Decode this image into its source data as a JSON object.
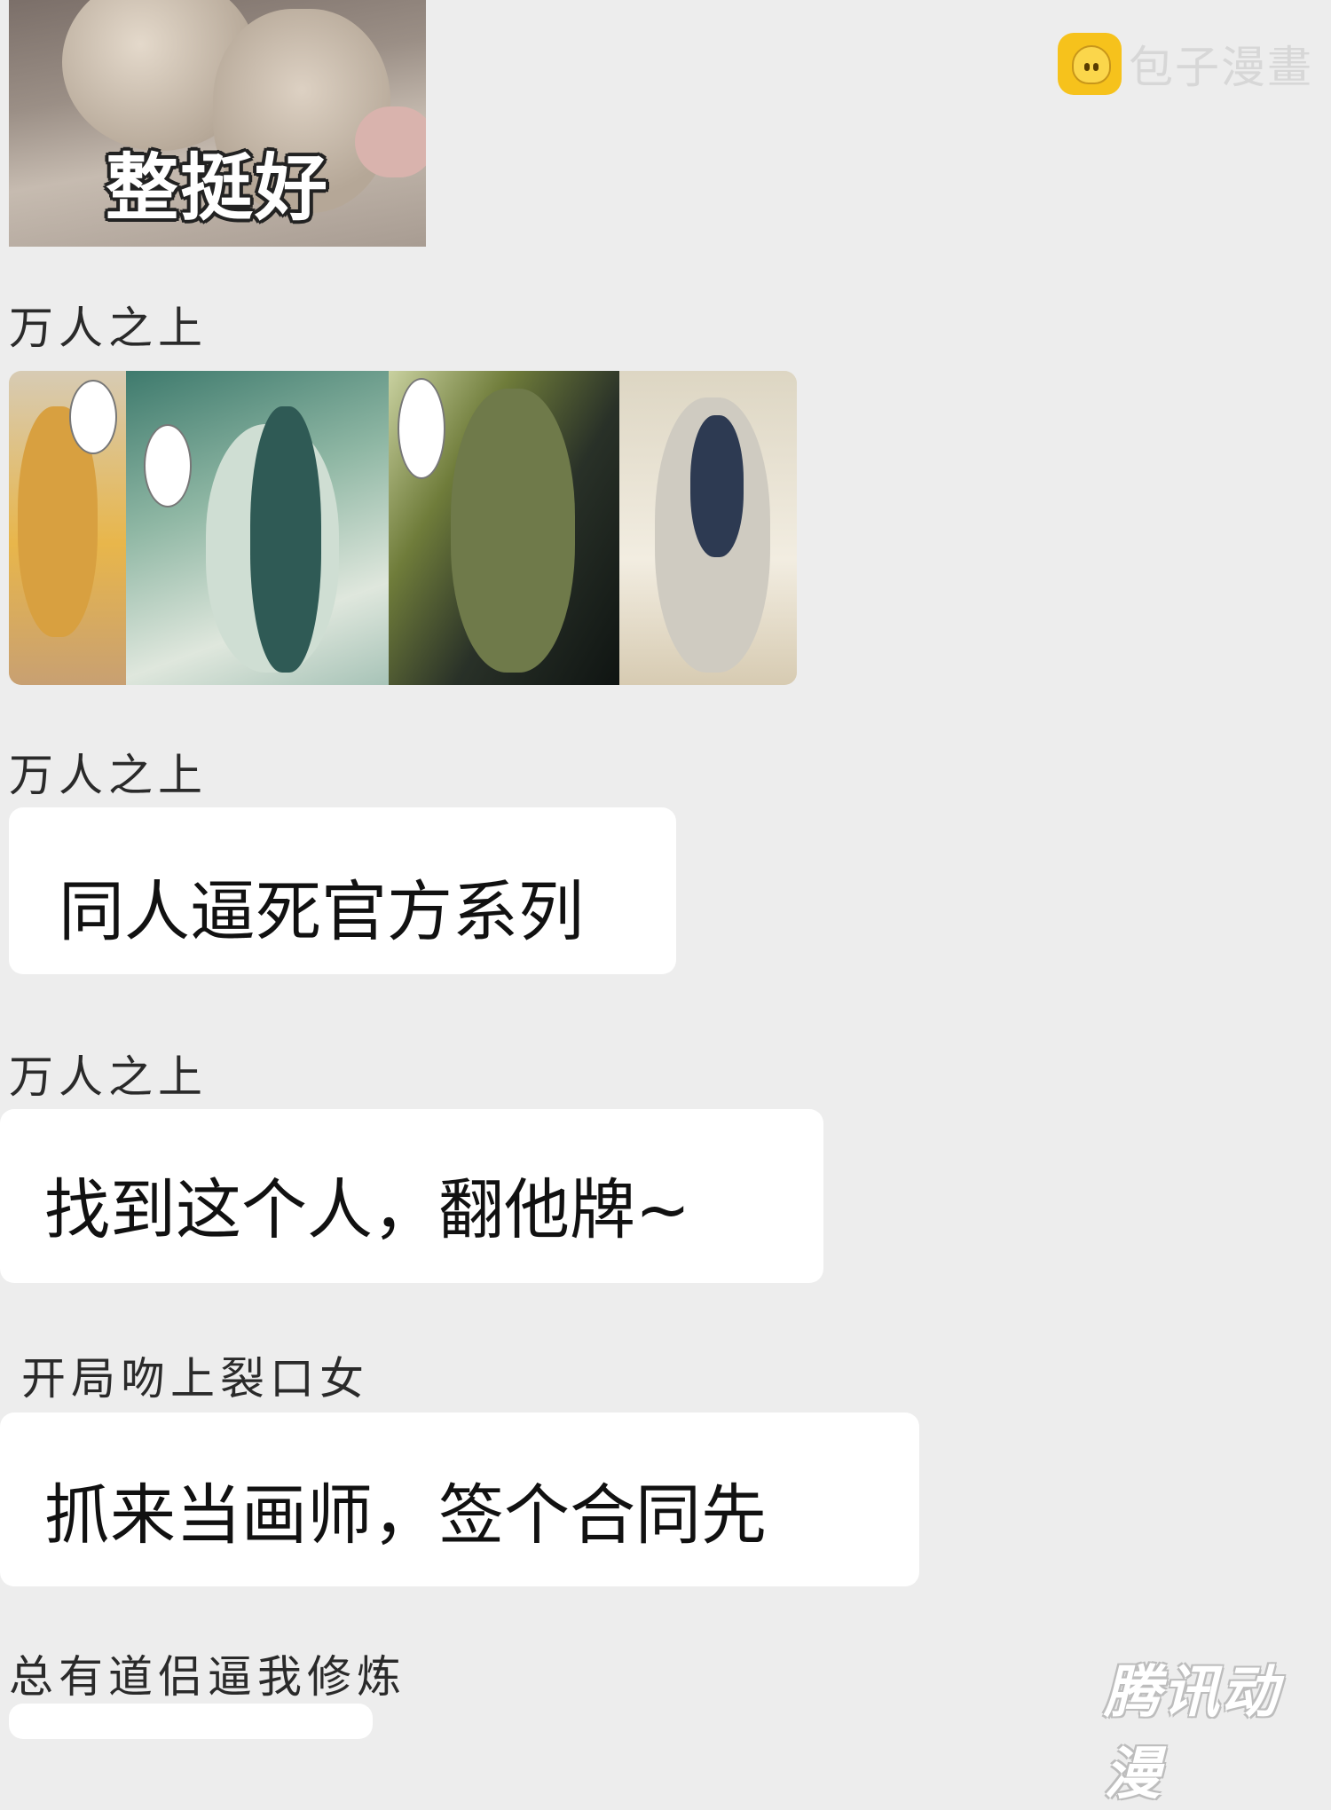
{
  "sticker": {
    "caption": "整挺好"
  },
  "watermark_top": {
    "text": "包子漫畫",
    "icon": "baozi-bun-icon"
  },
  "messages": [
    {
      "sender": "万人之上",
      "type": "image"
    },
    {
      "sender": "万人之上",
      "text": "同人逼死官方系列"
    },
    {
      "sender": "万人之上",
      "text": "找到这个人，翻他牌~"
    },
    {
      "sender": "开局吻上裂口女",
      "text": "抓来当画师，签个合同先"
    },
    {
      "sender": "总有道侣逼我修炼"
    }
  ],
  "watermark_bottom": {
    "text": "腾讯动漫"
  },
  "colors": {
    "background": "#ededed",
    "bubble": "#ffffff",
    "watermark_icon": "#f6c21c"
  }
}
